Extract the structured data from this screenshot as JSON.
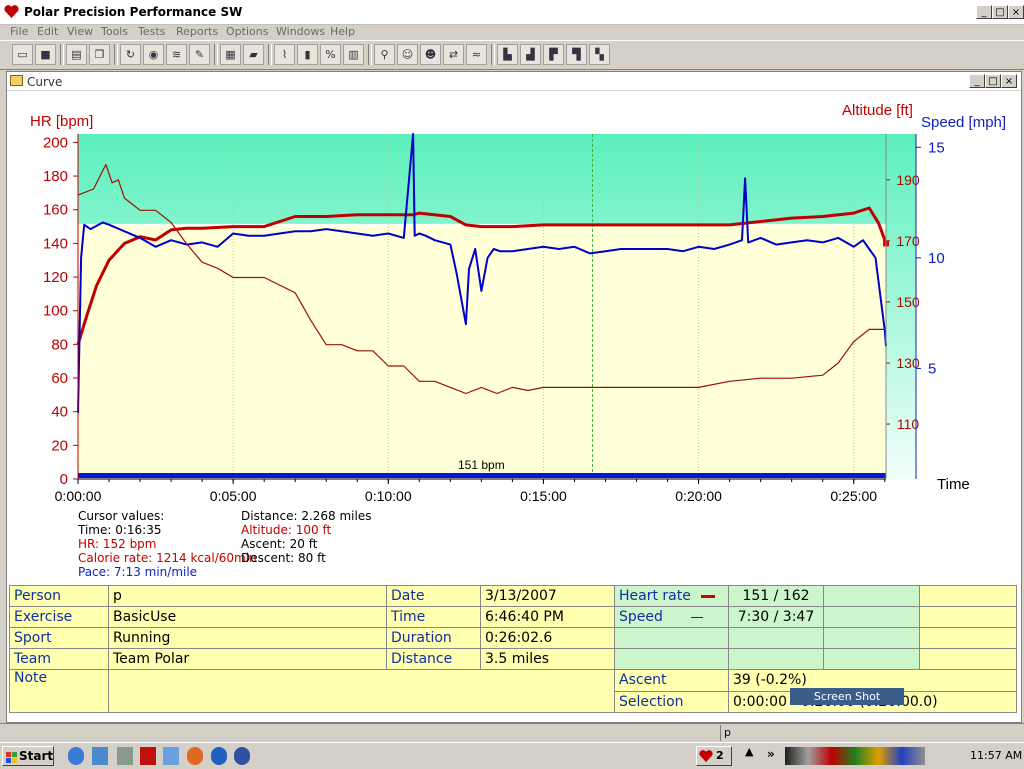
{
  "app": {
    "title": "Polar Precision Performance SW",
    "menu": [
      "File",
      "Edit",
      "View",
      "Tools",
      "Tests",
      "Reports",
      "Options",
      "Windows",
      "Help"
    ],
    "window_buttons": [
      "_",
      "□",
      "×"
    ]
  },
  "curve_window": {
    "title": "Curve",
    "buttons": [
      "_",
      "□",
      "×"
    ]
  },
  "chart_data": {
    "type": "line",
    "left_axis_label": "HR [bpm]",
    "right_axis_label_altitude": "Altitude [ft]",
    "right_axis_label_speed": "Speed [mph]",
    "x_axis_label": "Time",
    "hr_ticks": [
      "200",
      "180",
      "160",
      "140",
      "120",
      "100",
      "80",
      "60",
      "40",
      "20",
      "0"
    ],
    "altitude_ticks": [
      "190",
      "170",
      "150",
      "130",
      "110"
    ],
    "speed_ticks": [
      "15",
      "10",
      "5"
    ],
    "time_ticks": [
      "0:00:00",
      "0:05:00",
      "0:10:00",
      "0:15:00",
      "0:20:00",
      "0:25:00"
    ],
    "hr_ylim": [
      0,
      205
    ],
    "speed_ylim": [
      0,
      15.6
    ],
    "altitude_range_ft": [
      92,
      205
    ],
    "x_range_min": [
      0,
      26.04
    ],
    "limit_line_bpm": 151,
    "limit_label": "151 bpm",
    "cursor_time_min": 16.58,
    "colors": {
      "hr": "#c00000",
      "speed": "#0000c8",
      "altitude": "#a01000",
      "zone": "#ffffd8",
      "bg_top": "#60f0c0"
    },
    "series": [
      {
        "name": "HR",
        "unit": "bpm",
        "x_min": [
          0,
          0.3,
          0.6,
          1,
          1.5,
          2,
          2.5,
          3,
          3.5,
          4,
          5,
          6,
          7,
          8,
          9,
          10,
          10.8,
          11,
          12,
          12.5,
          13,
          14,
          15,
          16,
          17,
          18,
          19,
          20,
          21,
          22,
          23,
          24,
          25,
          25.5,
          25.8,
          26.04
        ],
        "values": [
          80,
          98,
          115,
          130,
          140,
          144,
          142,
          148,
          149,
          149,
          150,
          150,
          156,
          156,
          157,
          157,
          157,
          158,
          156,
          151,
          150,
          150,
          151,
          151,
          151,
          151,
          151,
          151,
          151,
          153,
          155,
          156,
          158,
          161,
          152,
          140
        ]
      },
      {
        "name": "Speed",
        "unit": "mph",
        "x_min": [
          0,
          0.1,
          0.2,
          0.4,
          0.8,
          1,
          1.5,
          2,
          2.5,
          3,
          3.5,
          4,
          4.5,
          5,
          5.5,
          6,
          6.5,
          7,
          7.5,
          8,
          8.5,
          9,
          9.5,
          10,
          10.5,
          10.8,
          10.85,
          11,
          11.2,
          11.5,
          12,
          12.2,
          12.5,
          12.6,
          12.8,
          13,
          13.2,
          13.4,
          13.6,
          14,
          14.5,
          15,
          15.5,
          16,
          16.5,
          17,
          17.5,
          18,
          18.5,
          19,
          19.5,
          20,
          20.5,
          21,
          21.4,
          21.5,
          21.6,
          22,
          22.5,
          23,
          23.5,
          24,
          24.5,
          25,
          25.3,
          25.5,
          25.7,
          26,
          26.04
        ],
        "values": [
          3,
          10,
          11.5,
          11.3,
          11.6,
          11.5,
          11.2,
          10.9,
          10.5,
          10.8,
          10.6,
          10.7,
          10.5,
          11.1,
          11.0,
          11.0,
          11.1,
          11.2,
          11.2,
          11.3,
          11.2,
          11.1,
          11.0,
          11.1,
          10.9,
          15.6,
          11.0,
          11.1,
          11.0,
          10.8,
          10.6,
          9.3,
          7.0,
          9.5,
          10.4,
          8.5,
          10.0,
          10.4,
          10.3,
          10.3,
          10.4,
          10.5,
          10.4,
          10.5,
          10.2,
          10.3,
          10.4,
          10.4,
          10.4,
          10.4,
          10.3,
          10.5,
          10.4,
          10.6,
          10.8,
          13.6,
          10.7,
          10.9,
          10.6,
          10.7,
          10.8,
          10.7,
          10.9,
          10.5,
          10.8,
          10.4,
          10.0,
          6.7,
          6.0
        ]
      },
      {
        "name": "Altitude",
        "unit": "ft",
        "x_min": [
          0,
          0.5,
          0.9,
          1.1,
          1.3,
          1.5,
          2,
          2.5,
          3,
          3.5,
          4,
          4.5,
          5,
          6,
          7,
          7.5,
          8,
          8.5,
          9,
          9.5,
          10,
          10.5,
          11,
          11.5,
          12,
          12.5,
          13,
          13.5,
          14,
          14.5,
          15,
          16,
          17,
          18,
          19,
          20,
          21,
          22,
          23,
          24,
          24.5,
          25,
          25.5,
          26,
          26.04
        ],
        "values": [
          185,
          187,
          195,
          189,
          190,
          184,
          180,
          180,
          176,
          169,
          163,
          161,
          158,
          158,
          153,
          144,
          136,
          136,
          134,
          134,
          129,
          129,
          124,
          124,
          122,
          120,
          122,
          120,
          122,
          121,
          122,
          122,
          122,
          122,
          122,
          122,
          124,
          125,
          125,
          126,
          130,
          137,
          141,
          141,
          141
        ]
      }
    ]
  },
  "cursor_values": {
    "heading": "Cursor values:",
    "time": "Time: 0:16:35",
    "hr": "HR: 152 bpm",
    "calorie": "Calorie rate: 1214 kcal/60min",
    "pace": "Pace: 7:13 min/mile",
    "distance": "Distance: 2.268 miles",
    "altitude": "Altitude: 100 ft",
    "ascent": "Ascent: 20 ft",
    "descent": "Descent: 80 ft"
  },
  "info_table": {
    "person_label": "Person",
    "person": "p",
    "exercise_label": "Exercise",
    "exercise": "BasicUse",
    "sport_label": "Sport",
    "sport": "Running",
    "team_label": "Team",
    "team": "Team Polar",
    "note_label": "Note",
    "date_label": "Date",
    "date": "3/13/2007",
    "time_label": "Time",
    "time": "6:46:40 PM",
    "duration_label": "Duration",
    "duration": "0:26:02.6",
    "distance_label": "Distance",
    "distance": "3.5 miles",
    "hr_label": "Heart rate",
    "hr": "151 / 162",
    "speed_label": "Speed",
    "speed": "7:30 / 3:47",
    "ascent_label": "Ascent",
    "ascent": "39 (-0.2%)",
    "selection_label": "Selection",
    "selection": "0:00:00 - 0:26:00 (0:26:00.0)"
  },
  "status": {
    "text": "p"
  },
  "tooltip": "Screen Shot",
  "taskbar": {
    "start": "Start",
    "clock": "11:57 AM",
    "badge": "2"
  }
}
